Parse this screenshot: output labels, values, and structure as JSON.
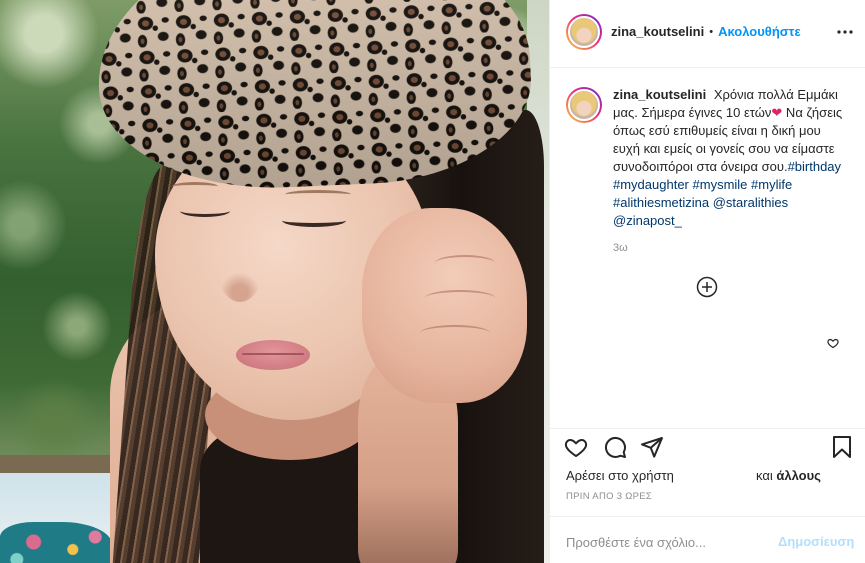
{
  "post": {
    "header": {
      "username": "zina_koutselini",
      "separator": "•",
      "follow_label": "Ακολουθήστε",
      "more_icon": "more-options-icon"
    },
    "caption": {
      "username": "zina_koutselini",
      "segments": [
        {
          "type": "text",
          "value": "Χρόνια πολλά Εμμάκι μας. Σήμερα έγινες 10 ετών"
        },
        {
          "type": "emoji",
          "value": "❤"
        },
        {
          "type": "text",
          "value": " Να ζήσεις όπως εσύ επιθυμείς είναι η δική μου ευχή και εμείς οι γονείς σου να είμαστε συνοδοιπόροι στα όνειρα σου."
        },
        {
          "type": "tag",
          "value": "#birthday"
        },
        {
          "type": "tag",
          "value": "#mydaughter"
        },
        {
          "type": "tag",
          "value": "#mysmile"
        },
        {
          "type": "tag",
          "value": "#mylife"
        },
        {
          "type": "tag",
          "value": "#alithiesmetizina"
        },
        {
          "type": "tag",
          "value": "@staralithies"
        },
        {
          "type": "tag",
          "value": "@zinapost_"
        }
      ],
      "age": "3ω"
    },
    "icons": {
      "load_more": "plus-circle-icon",
      "caption_like": "heart-outline-icon",
      "like": "heart-icon",
      "comment": "comment-icon",
      "share": "paper-plane-icon",
      "save": "bookmark-icon"
    },
    "likes": {
      "prefix": "Αρέσει στο χρήστη",
      "conjunction": "και",
      "others": "άλλους"
    },
    "timestamp": "ΠΡΙΝ ΑΠΟ 3 ΩΡΕΣ",
    "comment_box": {
      "placeholder": "Προσθέστε ένα σχόλιο...",
      "post_label": "Δημοσίευση"
    }
  },
  "colors": {
    "text": "#262626",
    "secondary": "#8e8e8e",
    "follow": "#0095f6",
    "hashtag": "#00376b",
    "post_disabled": "#b2dffc",
    "heart_emoji": "#e0245e",
    "border": "#efefef"
  }
}
